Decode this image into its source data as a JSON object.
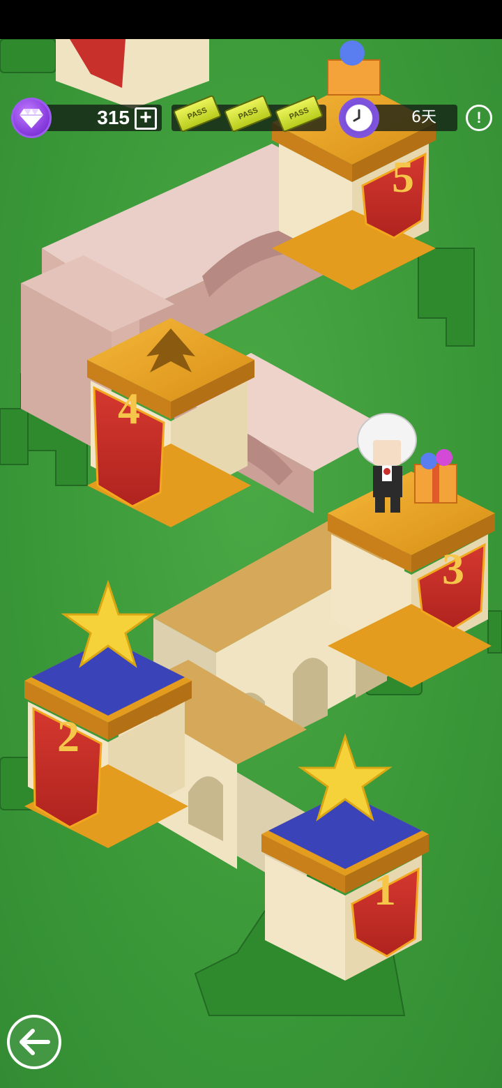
{
  "hud": {
    "gem_count": "315",
    "add_label": "+",
    "pass_label": "PASS",
    "pass_count_visible": 3,
    "timer_text": "6天",
    "info_label": "!"
  },
  "levels": [
    {
      "number": "1",
      "star": "gold"
    },
    {
      "number": "2",
      "star": "gold"
    },
    {
      "number": "3",
      "star": "none",
      "has_character": true,
      "has_gift": true
    },
    {
      "number": "4",
      "star": "locked"
    },
    {
      "number": "5",
      "star": "locked",
      "has_gift": true
    }
  ],
  "colors": {
    "grass": "#3f9c3c",
    "banner_red": "#c8302b",
    "banner_gold": "#f2a71e",
    "platform_blue": "#3a44b8",
    "stone_cream": "#f1e4c3",
    "bridge_pink": "#e8c9c1",
    "gem_purple": "#8b3fe0",
    "pass_yellow": "#d8e83a"
  }
}
